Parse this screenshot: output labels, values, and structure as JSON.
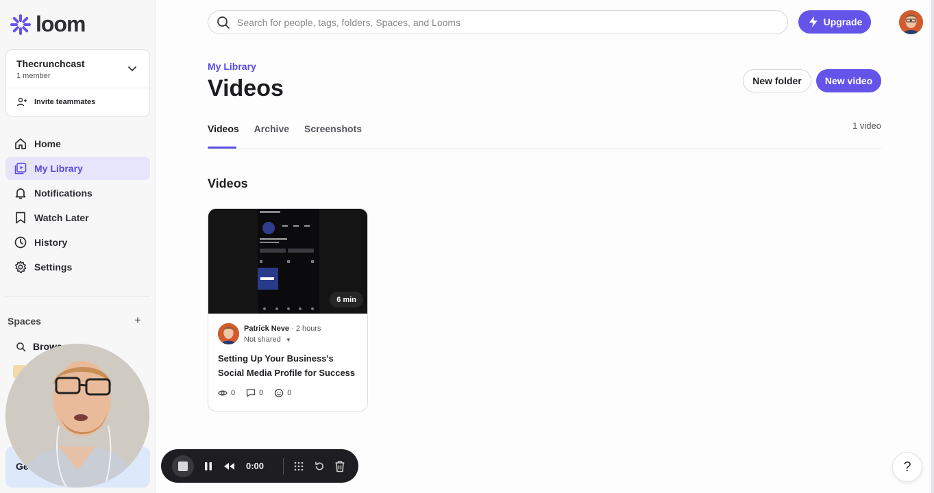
{
  "app": {
    "logo_text": "loom",
    "brand_color": "#6554e9"
  },
  "workspace": {
    "name": "Thecrunchcast",
    "members": "1 member",
    "invite_label": "Invite teammates"
  },
  "sidebar": {
    "items": [
      {
        "label": "Home",
        "icon": "home-icon"
      },
      {
        "label": "My Library",
        "icon": "library-icon",
        "active": true
      },
      {
        "label": "Notifications",
        "icon": "bell-icon"
      },
      {
        "label": "Watch Later",
        "icon": "bookmark-icon"
      },
      {
        "label": "History",
        "icon": "clock-icon"
      },
      {
        "label": "Settings",
        "icon": "gear-icon"
      }
    ],
    "spaces_label": "Spaces",
    "browse_label": "Brows",
    "get_started_label": "Ge"
  },
  "header": {
    "search_placeholder": "Search for people, tags, folders, Spaces, and Looms",
    "upgrade_label": "Upgrade"
  },
  "page": {
    "breadcrumb": "My Library",
    "title": "Videos",
    "new_folder_label": "New folder",
    "new_video_label": "New video",
    "tabs": [
      {
        "label": "Videos",
        "active": true
      },
      {
        "label": "Archive"
      },
      {
        "label": "Screenshots"
      }
    ],
    "video_count": "1 video",
    "section_title": "Videos"
  },
  "video_card": {
    "duration": "6 min",
    "author": "Patrick Neve",
    "time_ago": "2 hours",
    "sharing": "Not shared",
    "title": "Setting Up Your Business's Social Media Profile for Success",
    "views": "0",
    "comments": "0",
    "reactions": "0"
  },
  "recorder": {
    "time": "0:00"
  },
  "help_label": "?"
}
